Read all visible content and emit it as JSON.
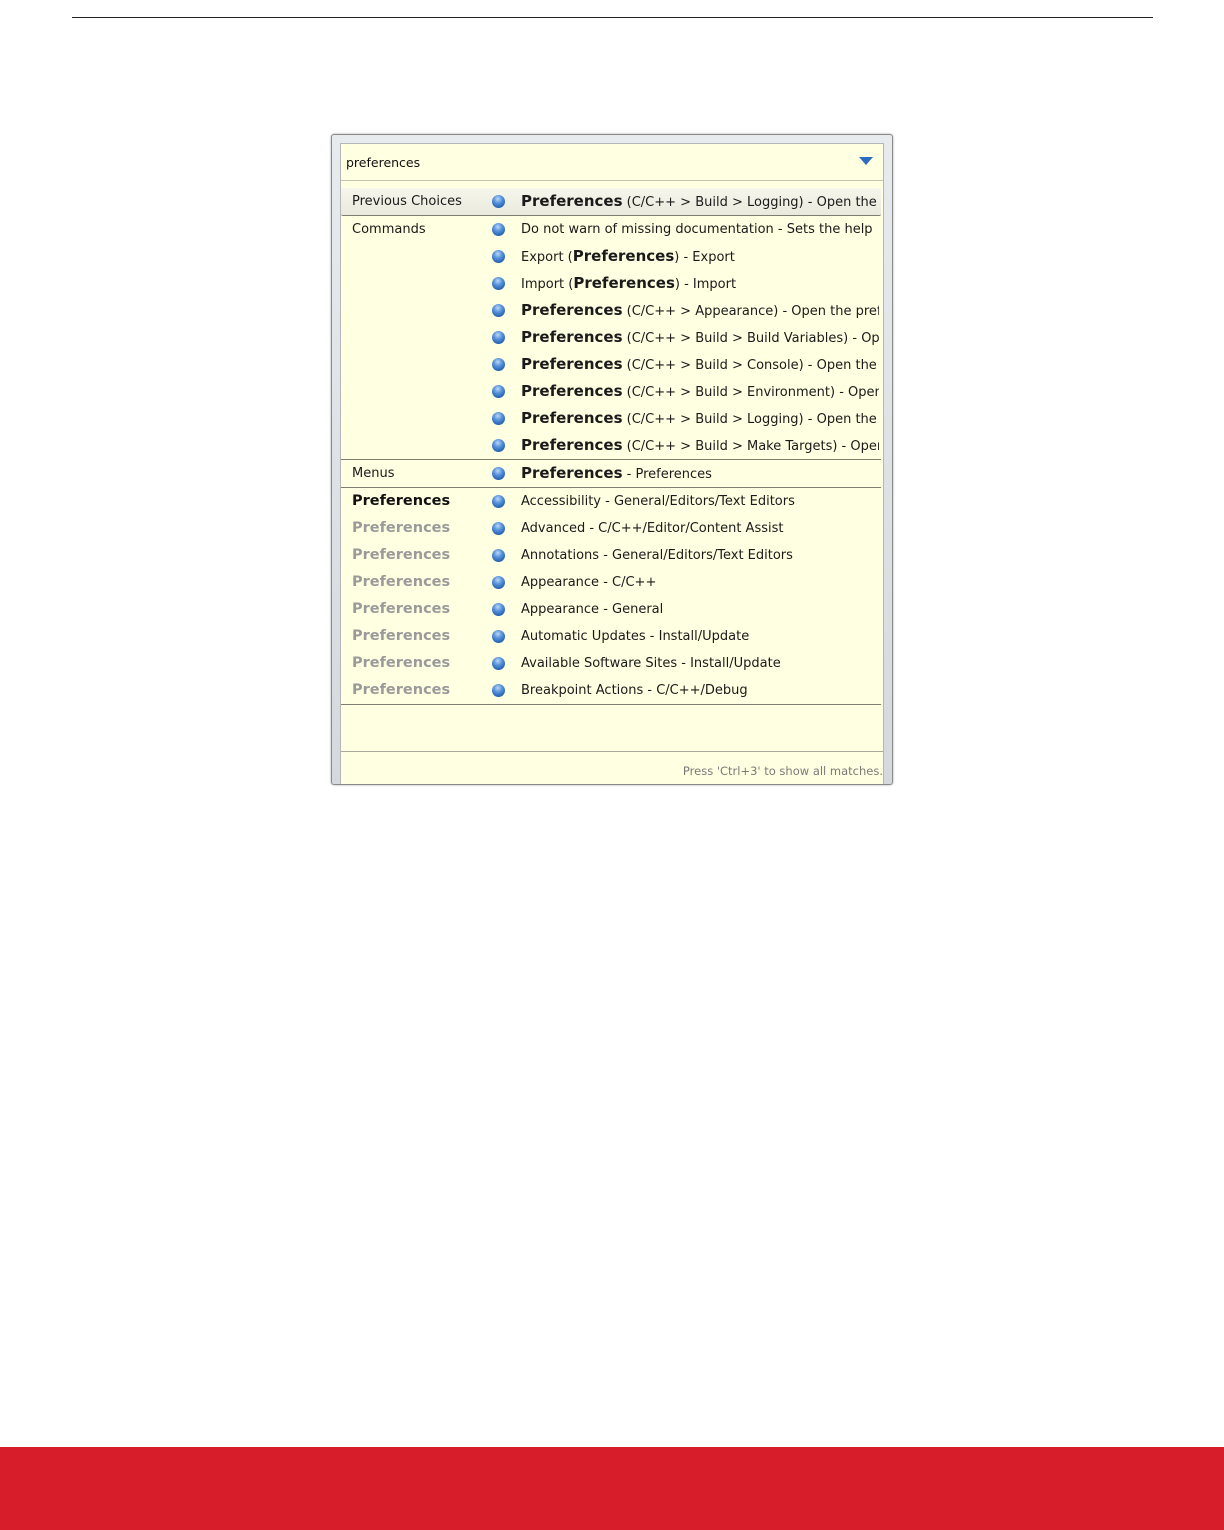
{
  "search": {
    "value": "preferences"
  },
  "rows": [
    {
      "category": "Previous Choices",
      "catStyle": "normal",
      "parts": [
        [
          "Preferences",
          true
        ],
        [
          " (C/C++ > Build > Logging) - Open the preference",
          false
        ]
      ],
      "selected": true,
      "sep": true
    },
    {
      "category": "Commands",
      "catStyle": "normal",
      "parts": [
        [
          "Do not warn of missing documentation - Sets the help",
          false
        ]
      ]
    },
    {
      "category": "",
      "catStyle": "normal",
      "parts": [
        [
          "Export (",
          false
        ],
        [
          "Preferences",
          true
        ],
        [
          ") - Export",
          false
        ]
      ]
    },
    {
      "category": "",
      "catStyle": "normal",
      "parts": [
        [
          "Import (",
          false
        ],
        [
          "Preferences",
          true
        ],
        [
          ") - Import",
          false
        ]
      ]
    },
    {
      "category": "",
      "catStyle": "normal",
      "parts": [
        [
          "Preferences",
          true
        ],
        [
          " (C/C++ > Appearance) - Open the preference",
          false
        ]
      ]
    },
    {
      "category": "",
      "catStyle": "normal",
      "parts": [
        [
          "Preferences",
          true
        ],
        [
          " (C/C++ > Build > Build Variables) - Open the",
          false
        ]
      ]
    },
    {
      "category": "",
      "catStyle": "normal",
      "parts": [
        [
          "Preferences",
          true
        ],
        [
          " (C/C++ > Build > Console) - Open the preference",
          false
        ]
      ]
    },
    {
      "category": "",
      "catStyle": "normal",
      "parts": [
        [
          "Preferences",
          true
        ],
        [
          " (C/C++ > Build > Environment) - Open the",
          false
        ]
      ]
    },
    {
      "category": "",
      "catStyle": "normal",
      "parts": [
        [
          "Preferences",
          true
        ],
        [
          " (C/C++ > Build > Logging) - Open the preference",
          false
        ]
      ]
    },
    {
      "category": "",
      "catStyle": "normal",
      "parts": [
        [
          "Preferences",
          true
        ],
        [
          " (C/C++ > Build > Make Targets) - Open the",
          false
        ]
      ],
      "sep": true
    },
    {
      "category": "Menus",
      "catStyle": "normal",
      "parts": [
        [
          "Preferences",
          true
        ],
        [
          " - Preferences",
          false
        ]
      ],
      "sep": true
    },
    {
      "category": "Preferences",
      "catStyle": "bold",
      "parts": [
        [
          "Accessibility - General/Editors/Text Editors",
          false
        ]
      ]
    },
    {
      "category": "Preferences",
      "catStyle": "dim",
      "parts": [
        [
          "Advanced - C/C++/Editor/Content Assist",
          false
        ]
      ]
    },
    {
      "category": "Preferences",
      "catStyle": "dim",
      "parts": [
        [
          "Annotations - General/Editors/Text Editors",
          false
        ]
      ]
    },
    {
      "category": "Preferences",
      "catStyle": "dim",
      "parts": [
        [
          "Appearance - C/C++",
          false
        ]
      ]
    },
    {
      "category": "Preferences",
      "catStyle": "dim",
      "parts": [
        [
          "Appearance - General",
          false
        ]
      ]
    },
    {
      "category": "Preferences",
      "catStyle": "dim",
      "parts": [
        [
          "Automatic Updates - Install/Update",
          false
        ]
      ]
    },
    {
      "category": "Preferences",
      "catStyle": "dim",
      "parts": [
        [
          "Available Software Sites - Install/Update",
          false
        ]
      ]
    },
    {
      "category": "Preferences",
      "catStyle": "dim",
      "parts": [
        [
          "Breakpoint Actions - C/C++/Debug",
          false
        ]
      ],
      "sep": true
    }
  ],
  "status": {
    "hint": "Press 'Ctrl+3' to show all matches."
  },
  "icons": {
    "bullet": "blue-sphere-icon",
    "dropdown": "chevron-down-icon"
  },
  "colors": {
    "popupBackground": "#ffffe1",
    "accent": "#2a6cc4",
    "footerBar": "#d81d2a"
  }
}
